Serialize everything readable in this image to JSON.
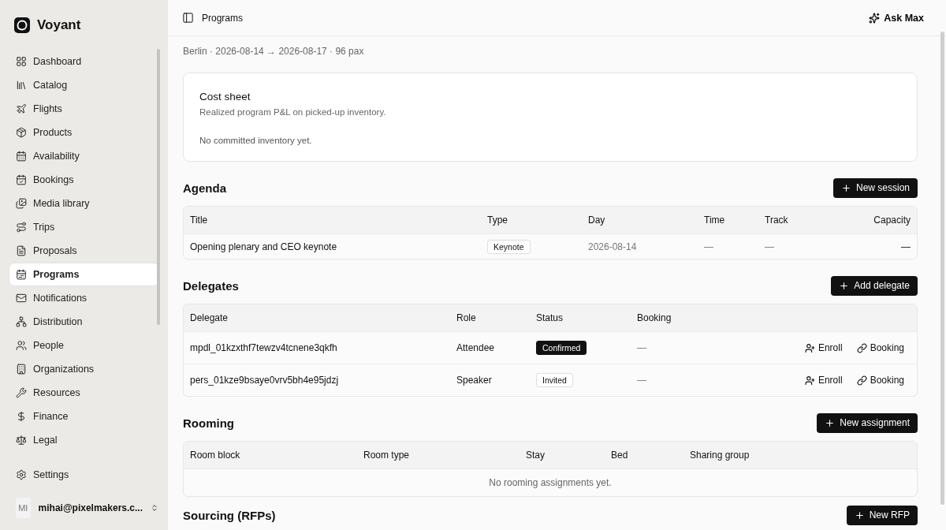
{
  "brand": {
    "name": "Voyant"
  },
  "sidebar": {
    "items": [
      {
        "label": "Dashboard",
        "selected": false
      },
      {
        "label": "Catalog",
        "selected": false
      },
      {
        "label": "Flights",
        "selected": false
      },
      {
        "label": "Products",
        "selected": false
      },
      {
        "label": "Availability",
        "selected": false
      },
      {
        "label": "Bookings",
        "selected": false
      },
      {
        "label": "Media library",
        "selected": false
      },
      {
        "label": "Trips",
        "selected": false
      },
      {
        "label": "Proposals",
        "selected": false
      },
      {
        "label": "Programs",
        "selected": true
      },
      {
        "label": "Notifications",
        "selected": false
      },
      {
        "label": "Distribution",
        "selected": false
      },
      {
        "label": "People",
        "selected": false
      },
      {
        "label": "Organizations",
        "selected": false
      },
      {
        "label": "Resources",
        "selected": false
      },
      {
        "label": "Finance",
        "selected": false
      },
      {
        "label": "Legal",
        "selected": false
      }
    ],
    "settings": "Settings",
    "user": {
      "initials": "MI",
      "email": "mihai@pixelmakers.c..."
    }
  },
  "header": {
    "breadcrumb": "Programs",
    "assistant": "Ask Max"
  },
  "program": {
    "meta": "Berlin · 2026-08-14 → 2026-08-17 · 96 pax"
  },
  "cost_sheet": {
    "title": "Cost sheet",
    "subtitle": "Realized program P&L on picked-up inventory.",
    "empty": "No committed inventory yet."
  },
  "sections": [
    {
      "title": "Agenda",
      "button": "New session",
      "columns": [
        "Title",
        "Type",
        "Day",
        "Time",
        "Track",
        "Capacity"
      ],
      "rows": [
        {
          "cells": [
            {
              "kind": "text",
              "text": "Opening plenary and CEO keynote"
            },
            {
              "kind": "badge",
              "text": "Keynote"
            },
            {
              "kind": "muted",
              "text": "2026-08-14"
            },
            {
              "kind": "muted",
              "text": "—"
            },
            {
              "kind": "muted",
              "text": "—"
            },
            {
              "kind": "end",
              "text": "—"
            }
          ],
          "actions": []
        }
      ]
    },
    {
      "title": "Delegates",
      "button": "Add delegate",
      "columns": [
        "Delegate",
        "Role",
        "Status",
        "Booking"
      ],
      "rows": [
        {
          "cells": [
            {
              "kind": "text",
              "text": "mpdl_01kzxthf7tewzv4tcnene3qkfh"
            },
            {
              "kind": "text",
              "text": "Attendee"
            },
            {
              "kind": "solid",
              "text": "Confirmed"
            },
            {
              "kind": "muted",
              "text": "—"
            }
          ],
          "actions": [
            "Enroll",
            "Booking"
          ]
        },
        {
          "cells": [
            {
              "kind": "text",
              "text": "pers_01kze9bsaye0vrv5bh4e95jdzj"
            },
            {
              "kind": "text",
              "text": "Speaker"
            },
            {
              "kind": "badge",
              "text": "Invited"
            },
            {
              "kind": "muted",
              "text": "—"
            }
          ],
          "actions": [
            "Enroll",
            "Booking"
          ]
        }
      ]
    },
    {
      "title": "Rooming",
      "button": "New assignment",
      "columns": [
        "Room block",
        "Room type",
        "Stay",
        "Bed",
        "Sharing group"
      ],
      "empty": "No rooming assignments yet."
    },
    {
      "title": "Sourcing (RFPs)",
      "button": "New RFP"
    }
  ]
}
